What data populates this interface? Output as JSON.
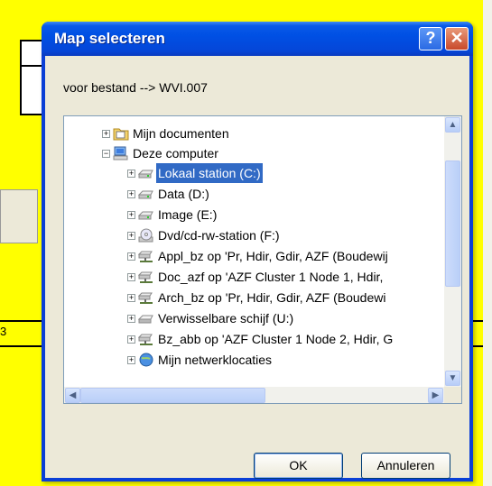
{
  "background": {
    "side_digit": "3"
  },
  "dialog": {
    "title": "Map selecteren",
    "help_glyph": "?",
    "close_glyph": "✕",
    "caption": "voor bestand --> WVI.007",
    "tree": [
      {
        "label": "Mijn documenten",
        "icon": "folder-documents-icon",
        "expander": "+"
      },
      {
        "label": "Deze computer",
        "icon": "computer-icon",
        "expander": "−"
      },
      {
        "label": "Lokaal station (C:)",
        "icon": "drive-icon",
        "expander": "+",
        "selected": true
      },
      {
        "label": "Data (D:)",
        "icon": "drive-icon",
        "expander": "+"
      },
      {
        "label": "Image (E:)",
        "icon": "drive-icon",
        "expander": "+"
      },
      {
        "label": "Dvd/cd-rw-station (F:)",
        "icon": "cd-drive-icon",
        "expander": "+"
      },
      {
        "label": "Appl_bz op 'Pr, Hdir, Gdir, AZF (Boudewij",
        "icon": "network-drive-icon",
        "expander": "+"
      },
      {
        "label": "Doc_azf op 'AZF Cluster 1 Node 1, Hdir,",
        "icon": "network-drive-icon",
        "expander": "+"
      },
      {
        "label": "Arch_bz op 'Pr, Hdir, Gdir, AZF (Boudewi",
        "icon": "network-drive-icon",
        "expander": "+"
      },
      {
        "label": "Verwisselbare schijf (U:)",
        "icon": "removable-drive-icon",
        "expander": "+"
      },
      {
        "label": "Bz_abb op 'AZF Cluster 1 Node 2, Hdir, G",
        "icon": "network-drive-icon",
        "expander": "+"
      },
      {
        "label": "Mijn netwerklocaties",
        "icon": "network-places-icon",
        "expander": "+"
      }
    ],
    "scroll": {
      "up": "▲",
      "down": "▼",
      "left": "◀",
      "right": "▶"
    },
    "ok_label": "OK",
    "cancel_label": "Annuleren"
  }
}
